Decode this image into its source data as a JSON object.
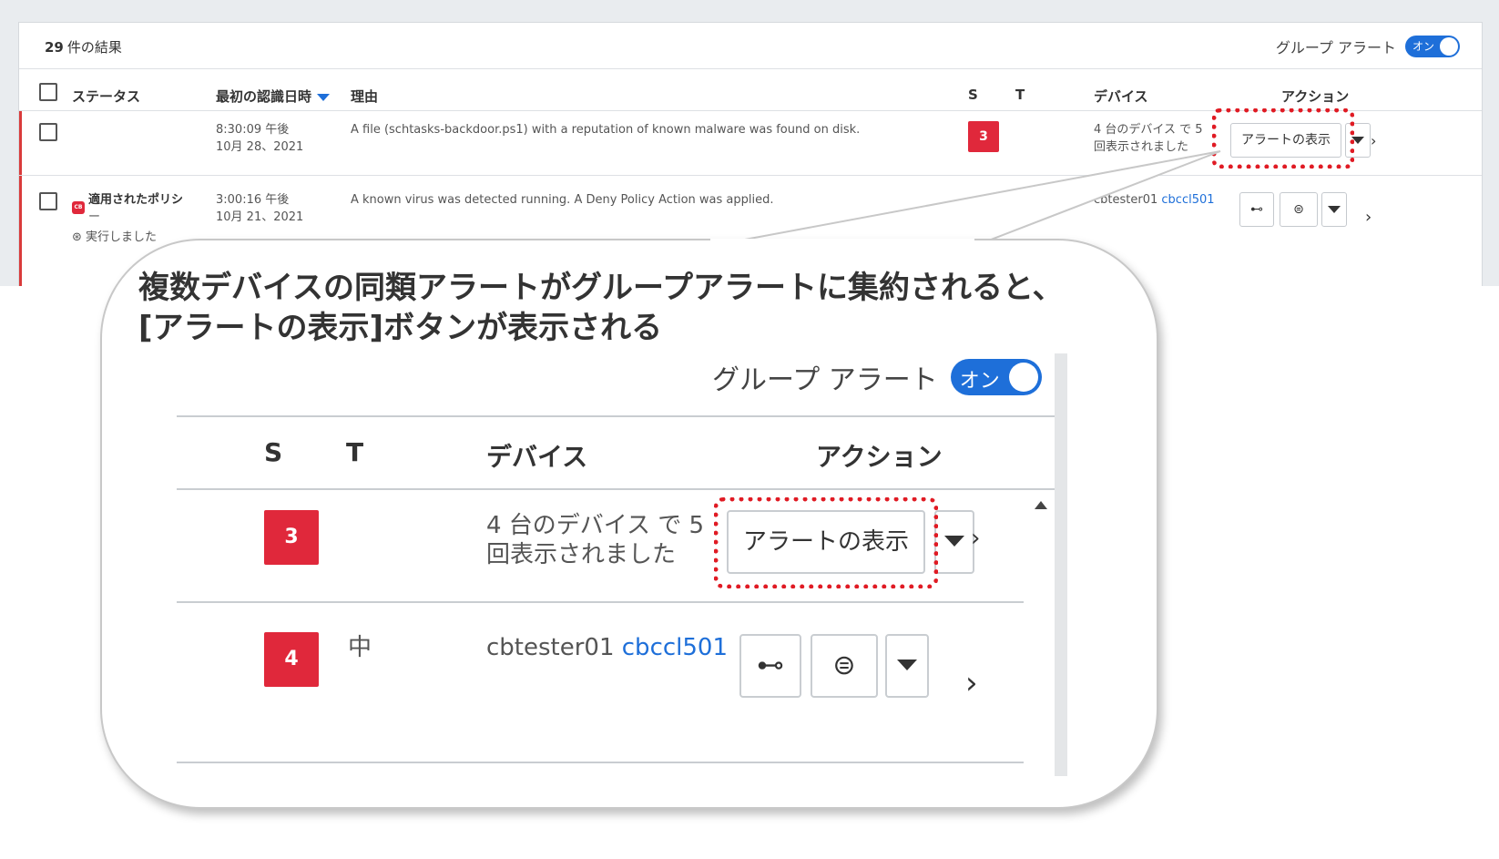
{
  "list": {
    "results_count": "29",
    "results_suffix": "件の結果",
    "group_alert_label": "グループ アラート",
    "toggle_on_label": "オン",
    "columns": {
      "status": "ステータス",
      "first_seen": "最初の認識日時",
      "reason": "理由",
      "s": "S",
      "t": "T",
      "device": "デバイス",
      "action": "アクション"
    },
    "rows": [
      {
        "time": "8:30:09 午後",
        "date": "10月 28、2021",
        "reason": "A file (schtasks-backdoor.ps1) with a reputation of known malware was found on disk.",
        "severity": "3",
        "device_line1": "4 台のデバイス で 5",
        "device_line2": "回表示されました",
        "view_alerts_button": "アラートの表示"
      },
      {
        "status_line1": "適用されたポリシ",
        "status_line2": "ー",
        "status_line3": "実行しました",
        "time": "3:00:16 午後",
        "date": "10月 21、2021",
        "reason": "A known virus was detected running. A Deny Policy Action was applied.",
        "device_name": "cbtester01",
        "device_link": "cbccl501"
      }
    ]
  },
  "callout": {
    "title_line1": "複数デバイスの同類アラートがグループアラートに集約されると、",
    "title_line2": "[アラートの表示]ボタンが表示される",
    "group_alert_label": "グループ アラート",
    "toggle_on_label": "オン",
    "columns": {
      "s": "S",
      "t": "T",
      "device": "デバイス",
      "action": "アクション"
    },
    "rows": [
      {
        "severity": "3",
        "device_line1": "4 台のデバイス で 5",
        "device_line2": "回表示されました",
        "view_alerts_button": "アラートの表示"
      },
      {
        "severity": "4",
        "target": "中",
        "device_name": "cbtester01",
        "device_link": "cbccl501"
      }
    ]
  },
  "colors": {
    "accent": "#1e6fd9",
    "severity": "#e0283b",
    "highlight": "#e01b24"
  }
}
